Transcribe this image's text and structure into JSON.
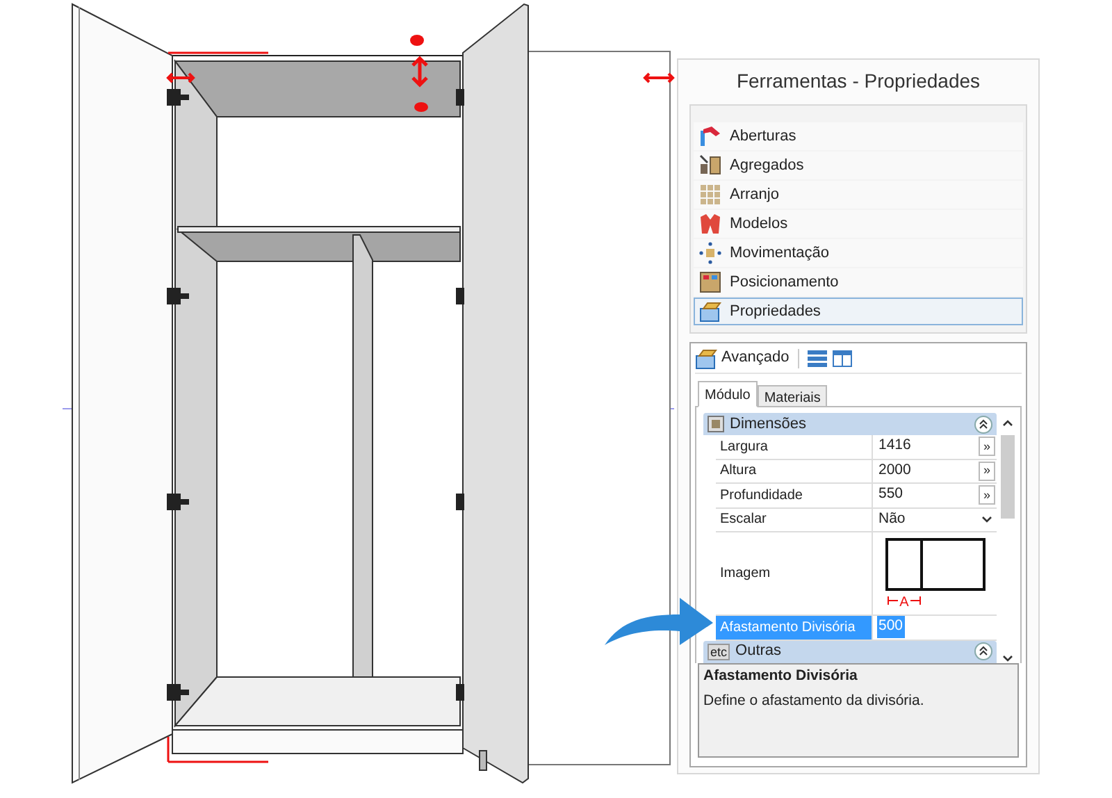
{
  "panel": {
    "title": "Ferramentas - Propriedades",
    "sections": [
      {
        "label": "Aberturas",
        "selected": false
      },
      {
        "label": "Agregados",
        "selected": false
      },
      {
        "label": "Arranjo",
        "selected": false
      },
      {
        "label": "Modelos",
        "selected": false
      },
      {
        "label": "Movimentação",
        "selected": false
      },
      {
        "label": "Posicionamento",
        "selected": false
      },
      {
        "label": "Propriedades",
        "selected": true
      }
    ]
  },
  "toolbar": {
    "label": "Avançado"
  },
  "tabs": [
    {
      "label": "Módulo",
      "selected": true
    },
    {
      "label": "Materiais",
      "selected": false
    }
  ],
  "categories": [
    {
      "label": "Dimensões",
      "kind": "dimensions",
      "rows": [
        {
          "name": "Largura",
          "value": "1416",
          "kind": "button",
          "button_text": "»",
          "selected": false
        },
        {
          "name": "Altura",
          "value": "2000",
          "kind": "button",
          "button_text": "»",
          "selected": false
        },
        {
          "name": "Profundidade",
          "value": "550",
          "kind": "button",
          "button_text": "»",
          "selected": false
        },
        {
          "name": "Escalar",
          "value": "Não",
          "kind": "dropdown",
          "selected": false
        },
        {
          "name": "Imagem",
          "kind": "image",
          "caption": "A",
          "selected": false
        },
        {
          "name": "Afastamento Divisória",
          "value": "500",
          "kind": "text",
          "selected": true
        }
      ]
    },
    {
      "label": "Outras",
      "kind": "other",
      "icon_text": "etc"
    }
  ],
  "description": {
    "title": "Afastamento Divisória",
    "text": "Define o afastamento da divisória."
  }
}
